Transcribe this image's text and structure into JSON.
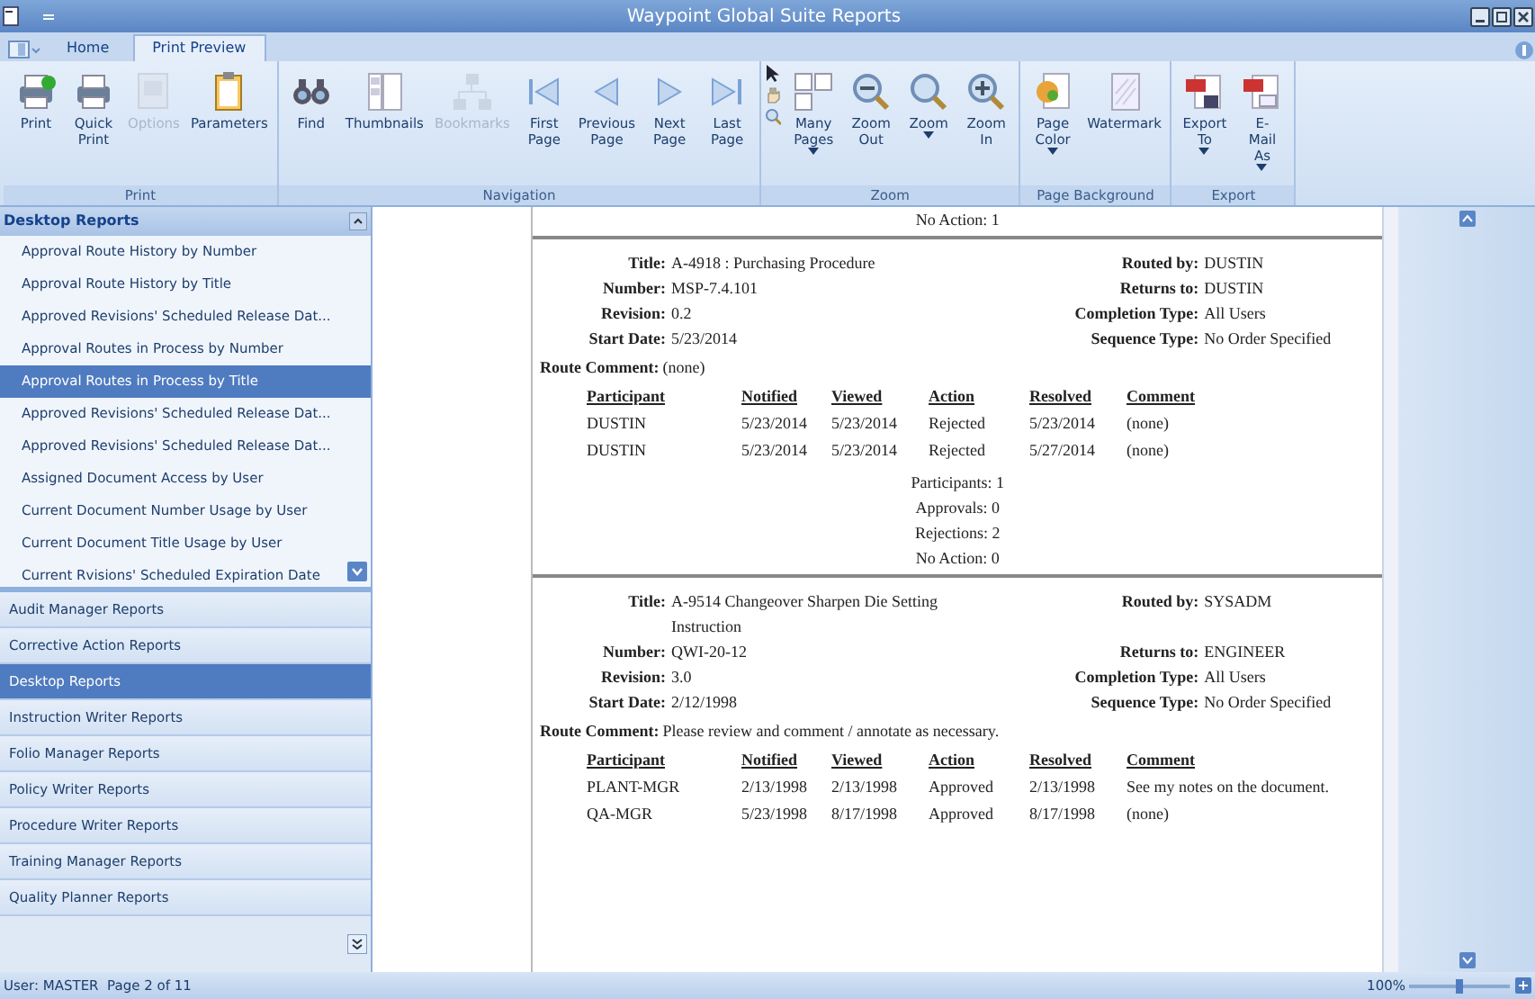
{
  "window": {
    "title": "Waypoint Global Suite Reports"
  },
  "tabs": [
    {
      "label": "Home",
      "selected": false
    },
    {
      "label": "Print Preview",
      "selected": true
    }
  ],
  "ribbon": [
    {
      "label": "Print",
      "buttons": [
        {
          "label": "Print",
          "disabled": false,
          "dropdown": false
        },
        {
          "label": "Quick Print",
          "disabled": false,
          "dropdown": false
        },
        {
          "label": "Options",
          "disabled": true,
          "dropdown": false
        },
        {
          "label": "Parameters",
          "disabled": false,
          "dropdown": false
        }
      ]
    },
    {
      "label": "Navigation",
      "buttons": [
        {
          "label": "Find",
          "disabled": false,
          "dropdown": false
        },
        {
          "label": "Thumbnails",
          "disabled": false,
          "dropdown": false
        },
        {
          "label": "Bookmarks",
          "disabled": true,
          "dropdown": false
        },
        {
          "label": "First Page",
          "disabled": false,
          "dropdown": false
        },
        {
          "label": "Previous Page",
          "disabled": false,
          "dropdown": false
        },
        {
          "label": "Next Page",
          "disabled": false,
          "dropdown": false
        },
        {
          "label": "Last Page",
          "disabled": false,
          "dropdown": false
        }
      ]
    },
    {
      "label": "Zoom",
      "buttons": [
        {
          "label": "Many Pages",
          "disabled": false,
          "dropdown": true
        },
        {
          "label": "Zoom Out",
          "disabled": false,
          "dropdown": false
        },
        {
          "label": "Zoom",
          "disabled": false,
          "dropdown": true
        },
        {
          "label": "Zoom In",
          "disabled": false,
          "dropdown": false
        }
      ]
    },
    {
      "label": "Page Background",
      "buttons": [
        {
          "label": "Page Color",
          "disabled": false,
          "dropdown": true
        },
        {
          "label": "Watermark",
          "disabled": false,
          "dropdown": false
        }
      ]
    },
    {
      "label": "Export",
      "buttons": [
        {
          "label": "Export To",
          "disabled": false,
          "dropdown": true
        },
        {
          "label": "E-Mail As",
          "disabled": false,
          "dropdown": true
        }
      ]
    }
  ],
  "sidebar": {
    "header": "Desktop Reports",
    "items": [
      {
        "label": "Approval Route History by Number",
        "selected": false
      },
      {
        "label": "Approval Route History by Title",
        "selected": false
      },
      {
        "label": "Approved Revisions' Scheduled Release Dat...",
        "selected": false
      },
      {
        "label": "Approval Routes in Process by Number",
        "selected": false
      },
      {
        "label": "Approval Routes in Process by Title",
        "selected": true
      },
      {
        "label": "Approved Revisions' Scheduled Release Dat...",
        "selected": false
      },
      {
        "label": "Approved Revisions' Scheduled Release Dat...",
        "selected": false
      },
      {
        "label": "Assigned Document Access by User",
        "selected": false
      },
      {
        "label": "Current Document Number Usage by User",
        "selected": false
      },
      {
        "label": "Current Document Title Usage by User",
        "selected": false
      },
      {
        "label": "Current Rvisions' Scheduled Expiration Date",
        "selected": false
      }
    ],
    "groups": [
      {
        "label": "Audit Manager Reports",
        "selected": false
      },
      {
        "label": "Corrective Action Reports",
        "selected": false
      },
      {
        "label": "Desktop Reports",
        "selected": true
      },
      {
        "label": "Instruction Writer Reports",
        "selected": false
      },
      {
        "label": "Folio Manager Reports",
        "selected": false
      },
      {
        "label": "Policy Writer Reports",
        "selected": false
      },
      {
        "label": "Procedure Writer Reports",
        "selected": false
      },
      {
        "label": "Training Manager Reports",
        "selected": false
      },
      {
        "label": "Quality Planner Reports",
        "selected": false
      }
    ]
  },
  "document": {
    "top_summary": [
      "No Action: 1"
    ],
    "records": [
      {
        "left": [
          {
            "label": "Title:",
            "value": "A-4918 : Purchasing Procedure"
          },
          {
            "label": "Number:",
            "value": "MSP-7.4.101"
          },
          {
            "label": "Revision:",
            "value": "0.2"
          },
          {
            "label": "Start Date:",
            "value": "5/23/2014"
          }
        ],
        "right": [
          {
            "label": "Routed by:",
            "value": "DUSTIN"
          },
          {
            "label": "Returns to:",
            "value": "DUSTIN"
          },
          {
            "label": "Completion Type:",
            "value": "All Users"
          },
          {
            "label": "Sequence Type:",
            "value": "No Order Specified"
          }
        ],
        "route_comment": {
          "label": "Route Comment:",
          "value": "(none)"
        },
        "columns": [
          "Participant",
          "Notified",
          "Viewed",
          "Action",
          "Resolved",
          "Comment"
        ],
        "rows": [
          [
            "DUSTIN",
            "5/23/2014",
            "5/23/2014",
            "Rejected",
            "5/23/2014",
            "(none)"
          ],
          [
            "DUSTIN",
            "5/23/2014",
            "5/23/2014",
            "Rejected",
            "5/27/2014",
            "(none)"
          ]
        ],
        "summary": [
          "Participants: 1",
          "Approvals: 0",
          "Rejections: 2",
          "No Action: 0"
        ]
      },
      {
        "left": [
          {
            "label": "Title:",
            "value": "A-9514 Changeover Sharpen Die Setting Instruction"
          },
          {
            "label": "Number:",
            "value": "QWI-20-12"
          },
          {
            "label": "Revision:",
            "value": "3.0"
          },
          {
            "label": "Start Date:",
            "value": "2/12/1998"
          }
        ],
        "right": [
          {
            "label": "Routed by:",
            "value": "SYSADM"
          },
          {
            "label": "Returns to:",
            "value": "ENGINEER"
          },
          {
            "label": "Completion Type:",
            "value": "All Users"
          },
          {
            "label": "Sequence Type:",
            "value": "No Order Specified"
          }
        ],
        "route_comment": {
          "label": "Route Comment:",
          "value": "Please review and comment / annotate as necessary."
        },
        "columns": [
          "Participant",
          "Notified",
          "Viewed",
          "Action",
          "Resolved",
          "Comment"
        ],
        "rows": [
          [
            "PLANT-MGR",
            "2/13/1998",
            "2/13/1998",
            "Approved",
            "2/13/1998",
            "See my notes on the document."
          ],
          [
            "QA-MGR",
            "5/23/1998",
            "8/17/1998",
            "Approved",
            "8/17/1998",
            "(none)"
          ]
        ]
      }
    ]
  },
  "status_bar": {
    "text": "User: MASTER  Page 2 of 11",
    "zoom": "100%",
    "zoom_slider": {
      "level": 0.5
    }
  }
}
